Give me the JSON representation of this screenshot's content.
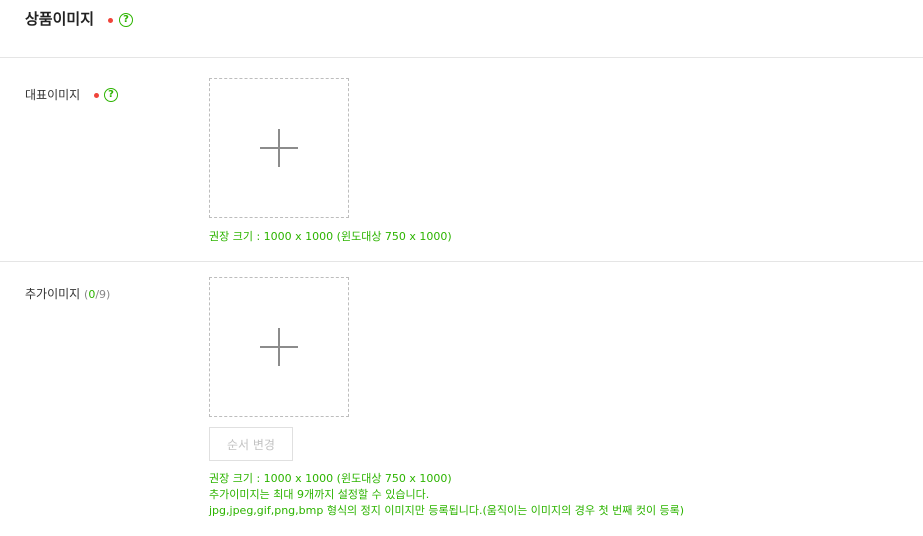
{
  "section": {
    "title": "상품이미지"
  },
  "representative": {
    "label": "대표이미지",
    "hint": "권장 크기 : 1000 x 1000 (윈도대상 750 x 1000)"
  },
  "additional": {
    "label": "추가이미지",
    "count_open": "(",
    "count_value": "0",
    "count_close": "/9)",
    "order_button": "순서 변경",
    "hints": [
      "권장 크기 : 1000 x 1000 (윈도대상 750 x 1000)",
      "추가이미지는 최대 9개까지 설정할 수 있습니다.",
      "jpg,jpeg,gif,png,bmp 형식의 정지 이미지만 등록됩니다.(움직이는 이미지의 경우 첫 번째 컷이 등록)"
    ]
  },
  "icons": {
    "required": "required-dot-icon",
    "help": "question-circle-icon",
    "add": "plus-icon"
  },
  "colors": {
    "accent": "#2db400",
    "required": "#f0443a"
  }
}
